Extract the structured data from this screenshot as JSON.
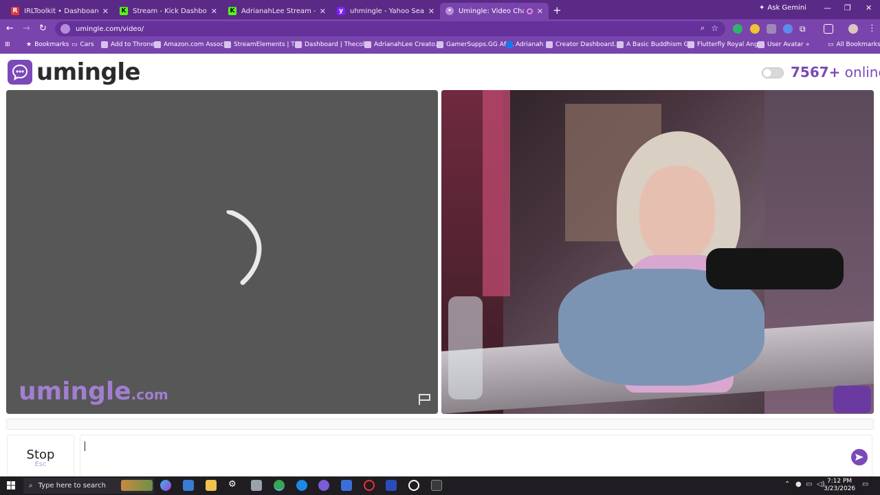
{
  "browser": {
    "tabs": [
      {
        "title": "IRLToolkit • Dashboard",
        "favicon": "irltoolkit-icon",
        "color": "#e03a3a",
        "active": false
      },
      {
        "title": "Stream - Kick Dashboard",
        "favicon": "kick-icon",
        "color": "#53fc18",
        "active": false
      },
      {
        "title": "AdrianahLee Stream - Watch Li",
        "favicon": "kick-icon",
        "color": "#53fc18",
        "active": false
      },
      {
        "title": "uhmingle - Yahoo Search Result",
        "favicon": "yahoo-icon",
        "color": "#7e1fff",
        "active": false
      },
      {
        "title": "Umingle: Video Chat with S",
        "favicon": "umingle-icon",
        "color": "#b68bdc",
        "active": true
      }
    ],
    "new_tab": "+",
    "ask_gemini": "Ask Gemini",
    "url": "umingle.com/video/",
    "bookmarks": [
      {
        "label": "Bookmarks",
        "icon": "star-icon"
      },
      {
        "label": "Cars",
        "icon": "folder-icon"
      },
      {
        "label": "Add to Throne",
        "icon": "throne-icon"
      },
      {
        "label": "Amazon.com Associ...",
        "icon": "amazon-icon"
      },
      {
        "label": "StreamElements | T...",
        "icon": "streamelements-icon"
      },
      {
        "label": "Dashboard | Thecol...",
        "icon": "globe-icon"
      },
      {
        "label": "AdrianahLee Creato...",
        "icon": "mk-icon"
      },
      {
        "label": "GamerSupps.GG Aff...",
        "icon": "gamersupps-icon"
      },
      {
        "label": "Adrianah",
        "icon": "facebook-icon"
      },
      {
        "label": "Creator Dashboard...",
        "icon": "creator-icon"
      },
      {
        "label": "A Basic Buddhism G...",
        "icon": "buddhism-icon"
      },
      {
        "label": "Flutterfly Royal Ang...",
        "icon": "google-icon"
      },
      {
        "label": "User Avatar",
        "icon": "globe-icon"
      }
    ],
    "more_bookmarks": "»",
    "all_bookmarks": "All Bookmarks"
  },
  "page": {
    "logo_text": "umingle",
    "online_count": "7567+",
    "online_label": "online",
    "watermark_main": "umingle",
    "watermark_suffix": ".com",
    "stop_label": "Stop",
    "stop_shortcut": "Esc",
    "chat_value": "",
    "accent": "#7b49b8"
  },
  "taskbar": {
    "search_placeholder": "Type here to search",
    "time": "7:12 PM",
    "date": "3/23/2026"
  }
}
